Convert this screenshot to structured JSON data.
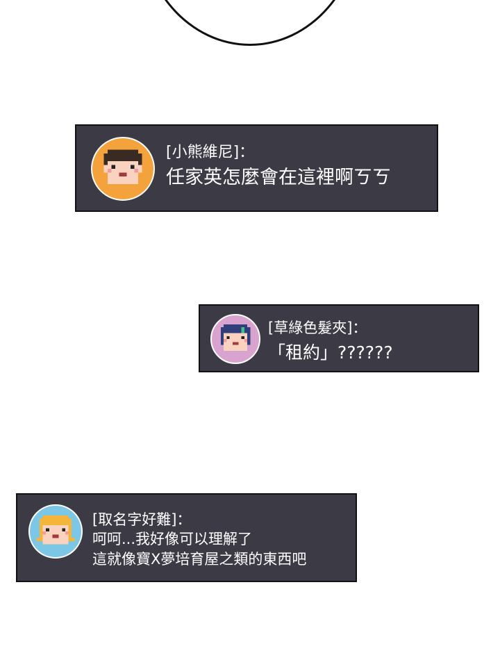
{
  "chat": [
    {
      "name": "[小熊維尼]：",
      "lines": [
        "任家英怎麼會在這裡啊ㄎㄎ"
      ],
      "avatar_icon": "boy-pixel-avatar-icon",
      "avatar_color": "#f4a23c"
    },
    {
      "name": "[草綠色髮夾]：",
      "lines": [
        "「租約」??????"
      ],
      "avatar_icon": "girl-pixel-avatar-icon",
      "avatar_color": "#d9a3cf"
    },
    {
      "name": "[取名字好難]：",
      "lines": [
        "呵呵...我好像可以理解了",
        "這就像寶X夢培育屋之類的東西吧"
      ],
      "avatar_icon": "blonde-pixel-avatar-icon",
      "avatar_color": "#7cc6e6"
    }
  ],
  "colors": {
    "box_bg": "#3b3a45",
    "text": "#ffffff"
  }
}
